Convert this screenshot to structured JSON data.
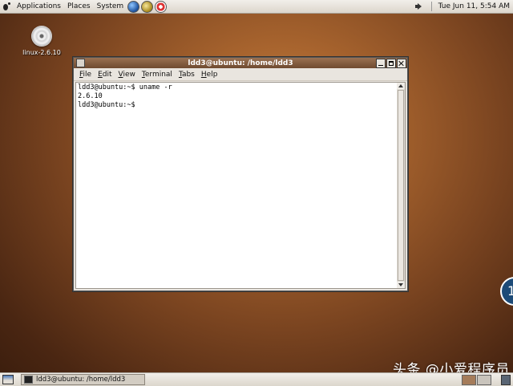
{
  "top_panel": {
    "menus": [
      "Applications",
      "Places",
      "System"
    ],
    "launchers": [
      "web-browser-icon",
      "email-icon",
      "help-icon"
    ],
    "clock": "Tue Jun 11,  5:54 AM"
  },
  "desktop": {
    "icons": [
      {
        "label": "linux-2.6.10",
        "icon": "cdrom-icon"
      }
    ]
  },
  "terminal": {
    "title": "ldd3@ubuntu: /home/ldd3",
    "menu": [
      "File",
      "Edit",
      "View",
      "Terminal",
      "Tabs",
      "Help"
    ],
    "lines": [
      "ldd3@ubuntu:~$ uname -r",
      "2.6.10",
      "ldd3@ubuntu:~$ "
    ]
  },
  "bottom_panel": {
    "task_label": "ldd3@ubuntu: /home/ldd3"
  },
  "overlay": {
    "watermark": "头条 @小爱程序员",
    "badge": "1"
  },
  "colors": {
    "titlebar": "#7e5638",
    "panel": "#e6e2dc",
    "desktop": "#8a5028"
  }
}
